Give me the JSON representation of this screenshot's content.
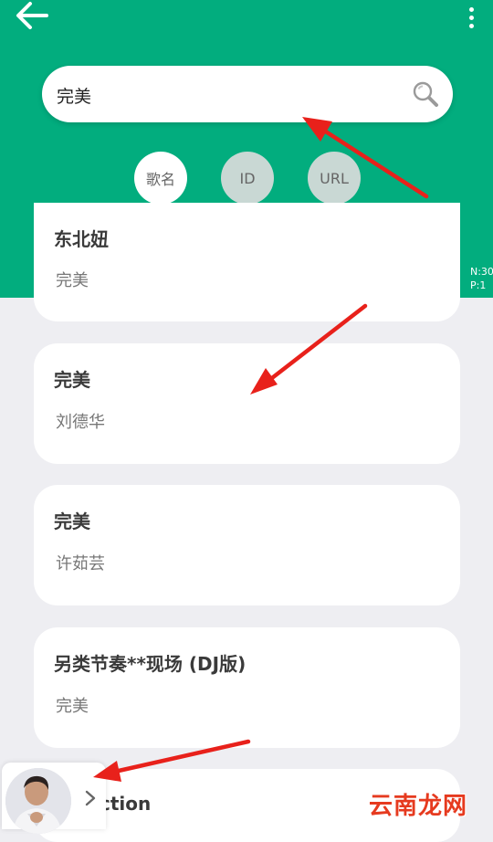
{
  "header": {
    "search": {
      "value": "完美",
      "placeholder": ""
    },
    "modes": [
      {
        "label": "歌名",
        "active": true
      },
      {
        "label": "ID",
        "active": false
      },
      {
        "label": "URL",
        "active": false
      }
    ],
    "counter": {
      "n": "N:30",
      "p": "P:1"
    }
  },
  "results": [
    {
      "title": "东北妞",
      "artist": "完美"
    },
    {
      "title": "完美",
      "artist": "刘德华"
    },
    {
      "title": "完美",
      "artist": "许茹芸"
    },
    {
      "title": "另类节奏**现场 (DJ版)",
      "artist": "完美"
    },
    {
      "title": "ction",
      "artist": ""
    }
  ],
  "watermark": "云南龙网",
  "colors": {
    "header_bg": "#02ad7e",
    "page_bg": "#eeeef2",
    "annotation_arrow": "#e8211b",
    "watermark": "#e63a1f"
  },
  "icons": {
    "back": "arrow-left-icon",
    "menu": "more-vertical-icon",
    "search": "search-icon",
    "player_toggle": "chevron-right-icon"
  }
}
